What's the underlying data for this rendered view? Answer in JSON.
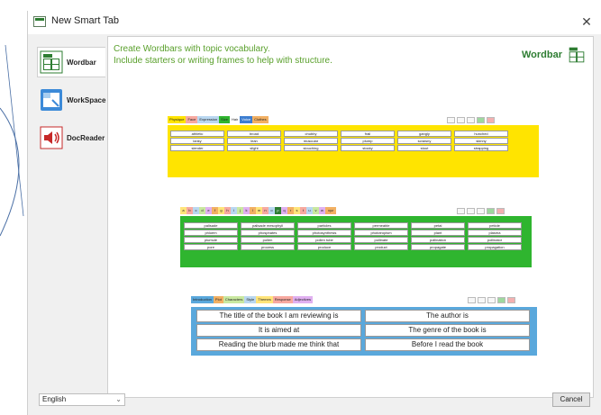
{
  "window": {
    "title": "New Smart Tab",
    "close_icon": "close-icon"
  },
  "nav": {
    "items": [
      {
        "label": "Wordbar",
        "icon": "wordbar-icon",
        "active": true
      },
      {
        "label": "WorkSpace",
        "icon": "workspace-icon",
        "active": false
      },
      {
        "label": "DocReader",
        "icon": "docreader-speaker-icon",
        "active": false
      }
    ]
  },
  "panel": {
    "description_line1": "Create Wordbars with topic vocabulary.",
    "description_line2": "Include starters or writing frames to help with structure.",
    "brand_label": "Wordbar",
    "brand_color": "#2e7d32",
    "accent_text_color": "#5aa02c"
  },
  "card1": {
    "color": "#ffe400",
    "tabs": [
      {
        "label": "Physique",
        "color": "#ffe400"
      },
      {
        "label": "Face",
        "color": "#f7a9a0"
      },
      {
        "label": "Expression",
        "color": "#b9d7f0"
      },
      {
        "label": "Size",
        "color": "#2fb52f"
      },
      {
        "label": "Hair",
        "color": "#ffffff"
      },
      {
        "label": "Voice",
        "color": "#3c7dd0"
      },
      {
        "label": "Clothes",
        "color": "#f2b063"
      }
    ],
    "rows": [
      [
        "athletic",
        "broad",
        "chubby",
        "frail",
        "gangly",
        "hunched"
      ],
      [
        "lanky",
        "lean",
        "muscular",
        "plump",
        "scrawny",
        "skinny"
      ],
      [
        "slender",
        "slight",
        "slouching",
        "stocky",
        "stout",
        "strapping"
      ]
    ]
  },
  "card2": {
    "color": "#2fb52f",
    "letters": [
      "a",
      "b",
      "c",
      "d",
      "e",
      "f",
      "g",
      "h",
      "i",
      "j",
      "k",
      "l",
      "m",
      "n",
      "o",
      "p",
      "q",
      "r",
      "s",
      "t",
      "u",
      "v",
      "w",
      "xyz"
    ],
    "rows": [
      [
        "palisade",
        "palisade mesophyll",
        "particles",
        "permeable",
        "petal",
        "petiole"
      ],
      [
        "phloem",
        "phosphates",
        "photosynthesis",
        "phototropism",
        "plant",
        "plasma"
      ],
      [
        "plumule",
        "pollen",
        "pollen tube",
        "pollinate",
        "pollination",
        "pollinator"
      ],
      [
        "pore",
        "process",
        "produce",
        "product",
        "propagate",
        "propagation"
      ]
    ]
  },
  "card3": {
    "color": "#5aa8dc",
    "tabs": [
      {
        "label": "Introduction",
        "color": "#5aa8dc"
      },
      {
        "label": "Plot",
        "color": "#f2b063"
      },
      {
        "label": "Characters",
        "color": "#c9e8a0"
      },
      {
        "label": "Style",
        "color": "#b9d7f0"
      },
      {
        "label": "Themes",
        "color": "#ffe47a"
      },
      {
        "label": "Response",
        "color": "#f7a9a0"
      },
      {
        "label": "Adjectives",
        "color": "#e0b0f0"
      }
    ],
    "rows": [
      [
        "The title of the book I am reviewing is",
        "The author is"
      ],
      [
        "It is aimed at",
        "The genre of the book is"
      ],
      [
        "Reading the blurb made me think that",
        "Before I read the book"
      ]
    ]
  },
  "footer": {
    "language": "English",
    "cancel_label": "Cancel"
  }
}
